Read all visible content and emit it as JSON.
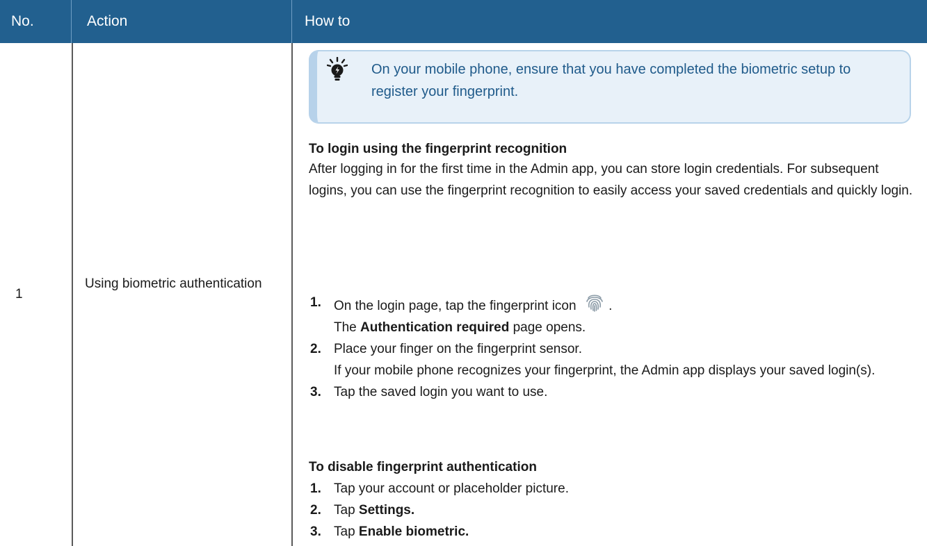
{
  "table": {
    "headers": {
      "no": "No.",
      "action": "Action",
      "how": "How to"
    },
    "row": {
      "no": "1",
      "action": "Using biometric authentication"
    }
  },
  "tip": {
    "icon": "lightbulb-icon",
    "text": "On your mobile phone, ensure that you have completed the biometric setup to register your fingerprint."
  },
  "login_section": {
    "title": "To login using the fingerprint recognition",
    "intro": "After logging in for the first time in the Admin app, you can store login credentials. For subsequent logins, you can use the fingerprint recognition to easily access your saved credentials and quickly login.",
    "steps": [
      {
        "num": "1.",
        "line1": "On the login page, tap the fingerprint icon",
        "line1_end": ".",
        "icon": "fingerprint-icon",
        "line2_pre": "The",
        "line2_bold": "Authentication required",
        "line2_post": "page opens."
      },
      {
        "num": "2.",
        "line1": "Place your finger on the fingerprint sensor.",
        "line2": "If your mobile phone recognizes your fingerprint, the Admin app displays your saved login(s)."
      },
      {
        "num": "3.",
        "line1": "Tap the saved login you want to use."
      }
    ]
  },
  "disable_section": {
    "title": "To disable fingerprint authentication",
    "steps": [
      {
        "num": "1.",
        "pre": "Tap your account or placeholder picture.",
        "bold": ""
      },
      {
        "num": "2.",
        "pre": "Tap",
        "bold": "Settings."
      },
      {
        "num": "3.",
        "pre": "Tap",
        "bold": "Enable biometric."
      }
    ]
  },
  "colors": {
    "header_bg": "#22608f",
    "tip_bg": "#e8f1f9",
    "tip_text": "#1f5a8a"
  }
}
